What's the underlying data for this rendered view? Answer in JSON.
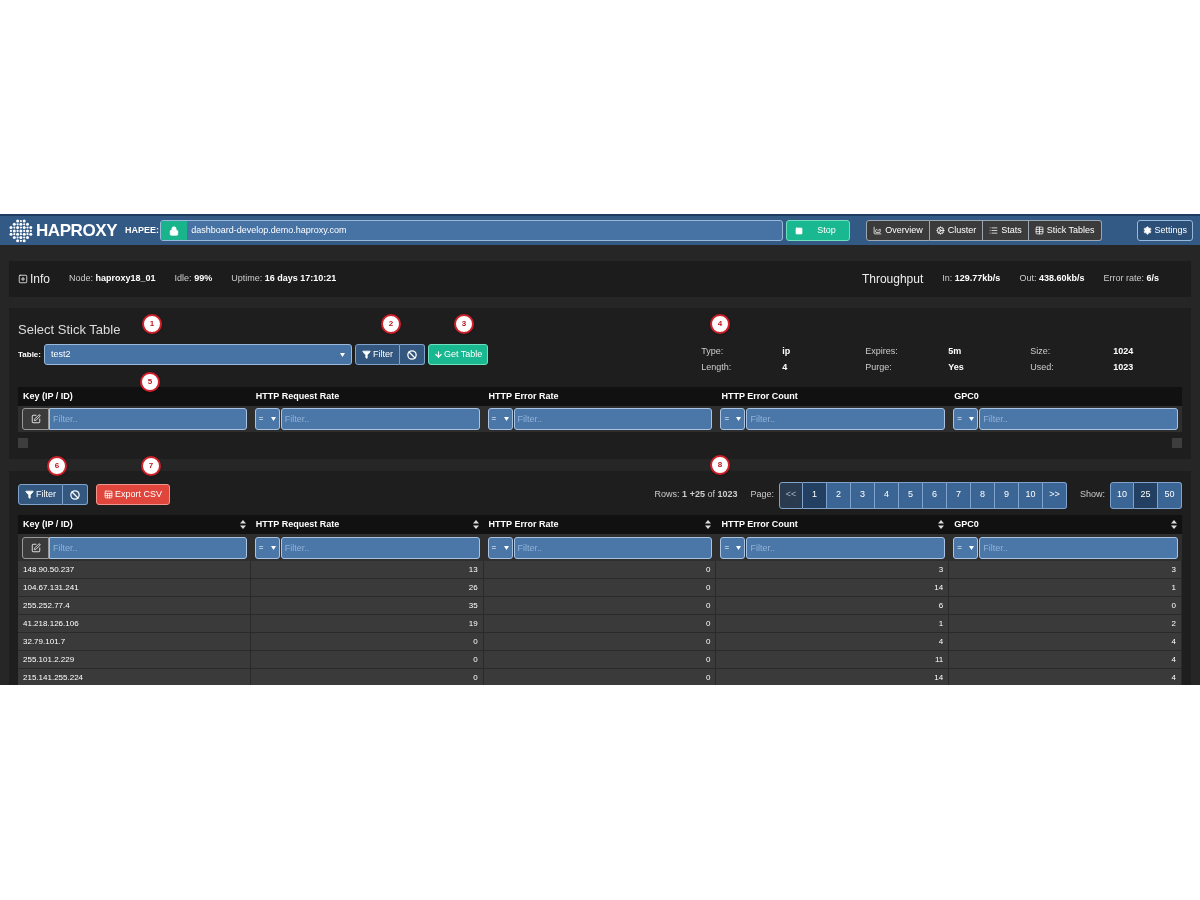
{
  "navbar": {
    "logo": "HAPROXY",
    "cluster_label": "HAPEE:",
    "url": "dashboard-develop.demo.haproxy.com",
    "stop_button": "Stop",
    "nav": [
      {
        "label": "Overview",
        "kind": "chart"
      },
      {
        "label": "Cluster",
        "kind": "cogs"
      },
      {
        "label": "Stats",
        "kind": "list"
      },
      {
        "label": "Stick Tables",
        "kind": "table"
      }
    ],
    "settings": "Settings"
  },
  "info": {
    "title": "Info",
    "stats": [
      {
        "label": "Node:",
        "value": "haproxy18_01"
      },
      {
        "label": "Idle:",
        "value": "99%"
      },
      {
        "label": "Uptime:",
        "value": "16 days 17:10:21"
      }
    ],
    "throughput_title": "Throughput",
    "throughput": [
      {
        "label": "In:",
        "value": "129.77kb/s"
      },
      {
        "label": "Out:",
        "value": "438.60kb/s"
      },
      {
        "label": "Error rate:",
        "value": "6/s"
      }
    ]
  },
  "select_panel": {
    "title": "Select Stick Table",
    "table_label": "Table:",
    "table_value": "test2",
    "filter_button": "Filter",
    "get_table_button": "Get Table",
    "meta": [
      {
        "label": "Type:",
        "value": "ip"
      },
      {
        "label": "Expires:",
        "value": "5m"
      },
      {
        "label": "Size:",
        "value": "1024"
      },
      {
        "label": "Length:",
        "value": "4"
      },
      {
        "label": "Purge:",
        "value": "Yes"
      },
      {
        "label": "Used:",
        "value": "1023"
      }
    ],
    "filter_columns": [
      {
        "heading": "Key (IP / ID)",
        "kind": "key",
        "placeholder": "Filter.."
      },
      {
        "heading": "HTTP Request Rate",
        "kind": "compare",
        "operator": "=",
        "placeholder": "Filter.."
      },
      {
        "heading": "HTTP Error Rate",
        "kind": "compare",
        "operator": "=",
        "placeholder": "Filter.."
      },
      {
        "heading": "HTTP Error Count",
        "kind": "compare",
        "operator": "=",
        "placeholder": "Filter.."
      },
      {
        "heading": "GPC0",
        "kind": "compare",
        "operator": "=",
        "placeholder": "Filter.."
      }
    ]
  },
  "results": {
    "filter_button": "Filter",
    "export_button": "Export CSV",
    "rows_summary": "Rows: **1** **+25** of **1023**",
    "page_label": "Page:",
    "pages": [
      {
        "label": "<<",
        "selected": false,
        "disabled": true
      },
      {
        "label": "1",
        "selected": true,
        "disabled": false
      },
      {
        "label": "2",
        "selected": false,
        "disabled": false
      },
      {
        "label": "3",
        "selected": false,
        "disabled": false
      },
      {
        "label": "4",
        "selected": false,
        "disabled": false
      },
      {
        "label": "5",
        "selected": false,
        "disabled": false
      },
      {
        "label": "6",
        "selected": false,
        "disabled": false
      },
      {
        "label": "7",
        "selected": false,
        "disabled": false
      },
      {
        "label": "8",
        "selected": false,
        "disabled": false
      },
      {
        "label": "9",
        "selected": false,
        "disabled": false
      },
      {
        "label": "10",
        "selected": false,
        "disabled": false
      },
      {
        "label": ">>",
        "selected": false,
        "disabled": false
      }
    ],
    "show_label": "Show:",
    "show_options": [
      {
        "label": "10",
        "selected": false
      },
      {
        "label": "25",
        "selected": true
      },
      {
        "label": "50",
        "selected": false
      }
    ],
    "columns": [
      {
        "heading": "Key (IP / ID)",
        "kind": "key",
        "placeholder": "Filter.."
      },
      {
        "heading": "HTTP Request Rate",
        "kind": "compare",
        "operator": "=",
        "placeholder": "Filter.."
      },
      {
        "heading": "HTTP Error Rate",
        "kind": "compare",
        "operator": "=",
        "placeholder": "Filter.."
      },
      {
        "heading": "HTTP Error Count",
        "kind": "compare",
        "operator": "=",
        "placeholder": "Filter.."
      },
      {
        "heading": "GPC0",
        "kind": "compare",
        "operator": "=",
        "placeholder": "Filter.."
      }
    ],
    "rows": [
      [
        "148.90.50.237",
        "13",
        "0",
        "3",
        "3"
      ],
      [
        "104.67.131.241",
        "26",
        "0",
        "14",
        "1"
      ],
      [
        "255.252.77.4",
        "35",
        "0",
        "6",
        "0"
      ],
      [
        "41.218.126.106",
        "19",
        "0",
        "1",
        "2"
      ],
      [
        "32.79.101.7",
        "0",
        "0",
        "4",
        "4"
      ],
      [
        "255.101.2.229",
        "0",
        "0",
        "11",
        "4"
      ],
      [
        "215.141.255.224",
        "0",
        "0",
        "14",
        "4"
      ]
    ]
  },
  "callouts": [
    "1",
    "2",
    "3",
    "4",
    "5",
    "6",
    "7",
    "8"
  ]
}
